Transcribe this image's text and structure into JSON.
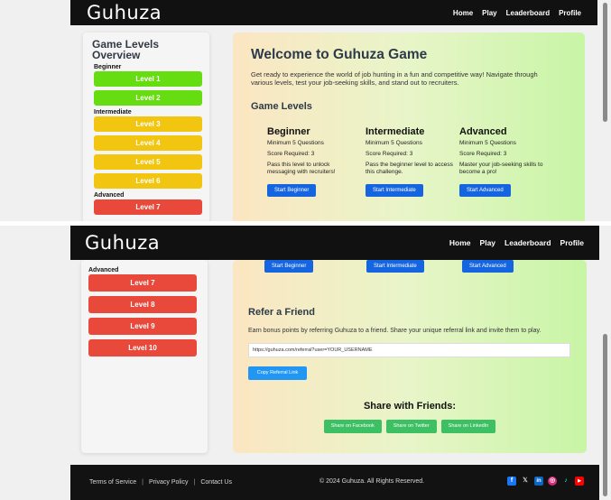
{
  "brand": {
    "logo": "Guhuza"
  },
  "nav": {
    "items": [
      "Home",
      "Play",
      "Leaderboard",
      "Profile"
    ]
  },
  "sidebar": {
    "title": "Game Levels Overview",
    "groups": {
      "beginner": "Beginner",
      "intermediate": "Intermediate",
      "advanced": "Advanced"
    },
    "levels": [
      "Level 1",
      "Level 2",
      "Level 3",
      "Level 4",
      "Level 5",
      "Level 6",
      "Level 7",
      "Level 8",
      "Level 9",
      "Level 10"
    ]
  },
  "welcome": {
    "title": "Welcome to Guhuza Game",
    "text": "Get ready to experience the world of job hunting in a fun and competitive way! Navigate through various levels, test your job-seeking skills, and stand out to recruiters."
  },
  "game_levels": {
    "heading": "Game Levels",
    "columns": [
      {
        "title": "Beginner",
        "min": "Minimum 5 Questions",
        "score": "Score Required: 3",
        "desc": "Pass this level to unlock messaging with recruiters!",
        "button": "Start Beginner"
      },
      {
        "title": "Intermediate",
        "min": "Minimum 5 Questions",
        "score": "Score Required: 3",
        "desc": "Pass the beginner level to access this challenge.",
        "button": "Start Intermediate"
      },
      {
        "title": "Advanced",
        "min": "Minimum 5 Questions",
        "score": "Score Required: 3",
        "desc": "Master your job-seeking skills to become a pro!",
        "button": "Start Advanced"
      }
    ]
  },
  "refer": {
    "heading": "Refer a Friend",
    "text": "Earn bonus points by referring Guhuza to a friend. Share your unique referral link and invite them to play.",
    "link": "https://guhuza.com/referral?user=YOUR_USERNAME",
    "copy_button": "Copy Referral Link"
  },
  "share": {
    "heading": "Share with Friends:",
    "buttons": [
      "Share on Facebook",
      "Share on Twitter",
      "Share on LinkedIn"
    ]
  },
  "footer": {
    "links": [
      "Terms of Service",
      "Privacy Policy",
      "Contact Us"
    ],
    "separator": "|",
    "copyright": "© 2024 Guhuza. All Rights Reserved.",
    "social": [
      {
        "icon": "facebook-icon",
        "glyph": "f",
        "color": "#1877f2"
      },
      {
        "icon": "x-icon",
        "glyph": "𝕏",
        "color": "#121212"
      },
      {
        "icon": "linkedin-icon",
        "glyph": "in",
        "color": "#0a66c2"
      },
      {
        "icon": "instagram-icon",
        "glyph": "◎",
        "color": "#d62976"
      },
      {
        "icon": "tiktok-icon",
        "glyph": "♪",
        "color": "#121212"
      },
      {
        "icon": "youtube-icon",
        "glyph": "▶",
        "color": "#ff0000"
      }
    ]
  },
  "colors": {
    "nav_bg": "#111111",
    "level_green": "#66dd11",
    "level_yellow": "#f2c511",
    "level_red": "#e8493b",
    "primary_button": "#1565e0",
    "share_button": "#3dbf64"
  }
}
